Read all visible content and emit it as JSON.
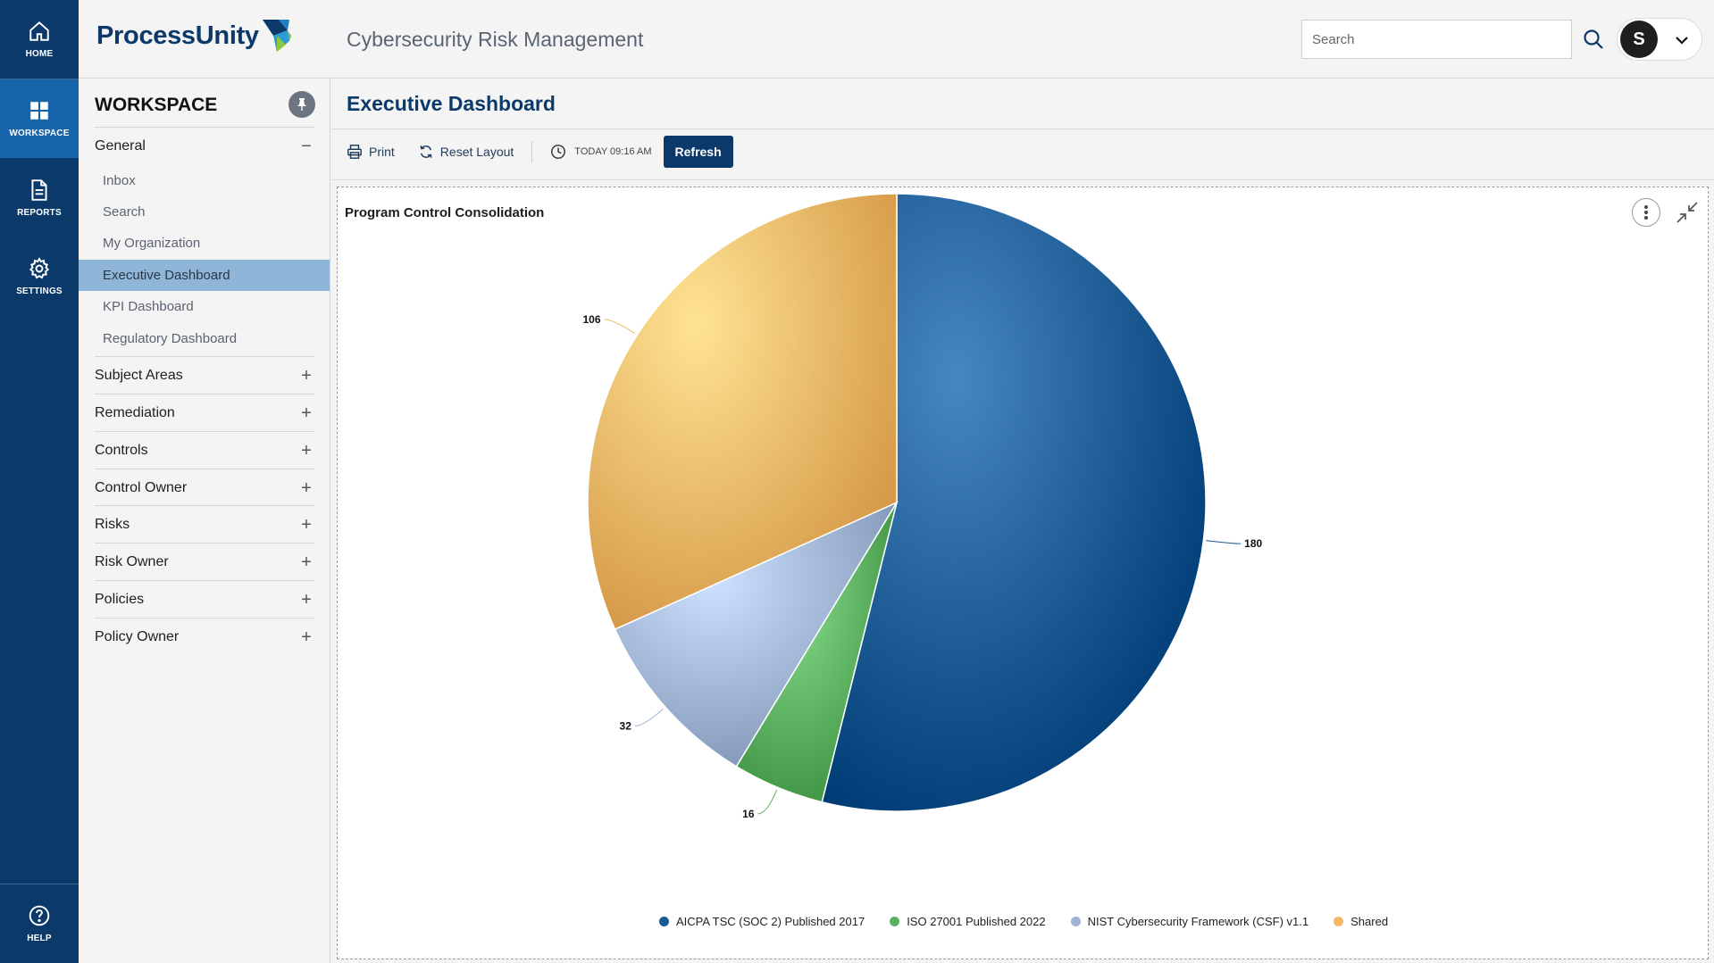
{
  "rail": {
    "home": "HOME",
    "workspace": "WORKSPACE",
    "reports": "REPORTS",
    "settings": "SETTINGS",
    "help": "HELP"
  },
  "header": {
    "logo_text": "ProcessUnity",
    "app_title": "Cybersecurity Risk Management",
    "search_placeholder": "Search",
    "user_initial": "S"
  },
  "sidebar": {
    "title": "WORKSPACE",
    "general": {
      "label": "General",
      "sign": "−",
      "items": [
        "Inbox",
        "Search",
        "My Organization",
        "Executive Dashboard",
        "KPI Dashboard",
        "Regulatory Dashboard"
      ],
      "active": "Executive Dashboard"
    },
    "sections": [
      {
        "label": "Subject Areas",
        "sign": "+"
      },
      {
        "label": "Remediation",
        "sign": "+"
      },
      {
        "label": "Controls",
        "sign": "+"
      },
      {
        "label": "Control Owner",
        "sign": "+"
      },
      {
        "label": "Risks",
        "sign": "+"
      },
      {
        "label": "Risk Owner",
        "sign": "+"
      },
      {
        "label": "Policies",
        "sign": "+"
      },
      {
        "label": "Policy Owner",
        "sign": "+"
      }
    ]
  },
  "main": {
    "page_title": "Executive Dashboard",
    "toolbar": {
      "print": "Print",
      "reset_layout": "Reset Layout",
      "timestamp": "TODAY 09:16 AM",
      "refresh": "Refresh"
    },
    "panel": {
      "title": "Program Control Consolidation"
    }
  },
  "chart_data": {
    "type": "pie",
    "title": "Program Control Consolidation",
    "legend_position": "bottom",
    "slices": [
      {
        "name": "AICPA TSC (SOC 2) Published 2017",
        "value": 180,
        "color": "#1a5a94"
      },
      {
        "name": "ISO 27001 Published 2022",
        "value": 16,
        "color": "#5cb160"
      },
      {
        "name": "NIST Cybersecurity Framework (CSF) v1.1",
        "value": 32,
        "color": "#9fb4d4"
      },
      {
        "name": "Shared",
        "value": 106,
        "color": "#f3b766"
      }
    ]
  }
}
